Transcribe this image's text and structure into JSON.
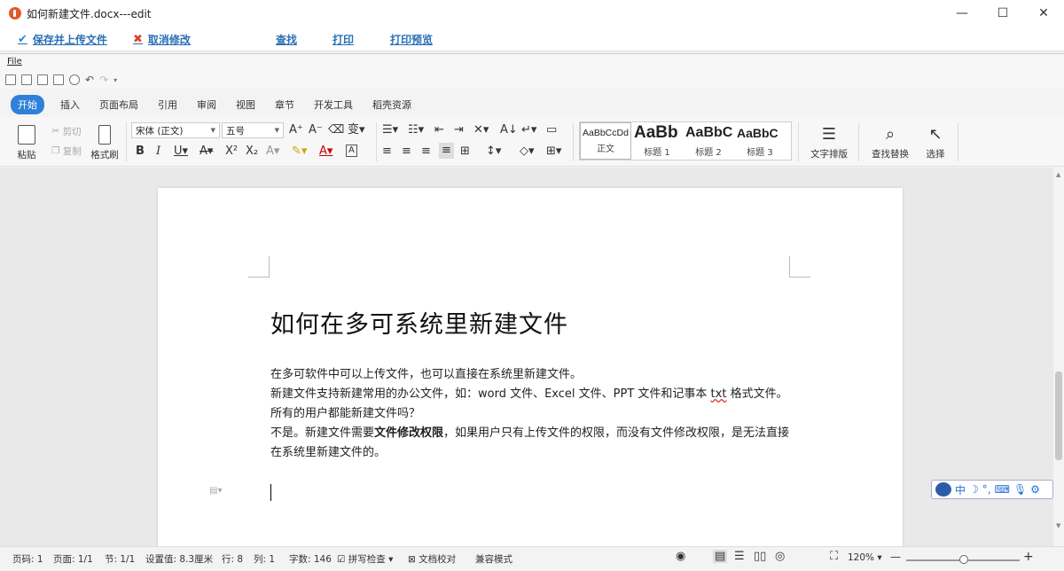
{
  "window": {
    "title": "如何新建文件.docx---edit",
    "minimize": "—",
    "maximize": "☐",
    "close": "✕"
  },
  "actions": {
    "save_upload": "保存并上传文件",
    "cancel_edit": "取消修改",
    "find": "查找",
    "print": "打印",
    "print_preview": "打印预览"
  },
  "menu": {
    "file": "File"
  },
  "tabs": [
    "开始",
    "插入",
    "页面布局",
    "引用",
    "审阅",
    "视图",
    "章节",
    "开发工具",
    "稻壳资源"
  ],
  "ribbon": {
    "paste": "粘贴",
    "cut": "剪切",
    "copy": "复制",
    "format_painter": "格式刷",
    "font_name": "宋体 (正文)",
    "font_size": "五号",
    "styles": [
      {
        "sample": "AaBbCcDd",
        "label": "正文"
      },
      {
        "sample": "AaBb",
        "label": "标题 1"
      },
      {
        "sample": "AaBbC",
        "label": "标题 2"
      },
      {
        "sample": "AaBbC",
        "label": "标题 3"
      }
    ],
    "text_layout": "文字排版",
    "find_replace": "查找替换",
    "select": "选择"
  },
  "document": {
    "title": "如何在多可系统里新建文件",
    "line1": "在多可软件中可以上传文件，也可以直接在系统里新建文件。",
    "line2_a": "新建文件支持新建常用的办公文件，如：word 文件、Excel 文件、PPT 文件和记事本 ",
    "line2_spell": "txt",
    "line2_b": " 格式文件。",
    "line3": "所有的用户都能新建文件吗？",
    "line4_a": "不是。新建文件需要",
    "line4_bold": "文件修改权限",
    "line4_b": "，如果用户只有上传文件的权限，而没有文件修改权限，是无法直接在系统里新建文件的。"
  },
  "ime": {
    "mode": "中"
  },
  "status": {
    "page_no": "页码: 1",
    "page": "页面: 1/1",
    "section": "节: 1/1",
    "setting": "设置值: 8.3厘米",
    "row": "行: 8",
    "col": "列: 1",
    "word_count": "字数: 146",
    "spell_check": "拼写检查",
    "doc_proof": "文档校对",
    "compat_mode": "兼容模式",
    "zoom": "120%",
    "zoom_out": "—",
    "zoom_in": "+"
  }
}
